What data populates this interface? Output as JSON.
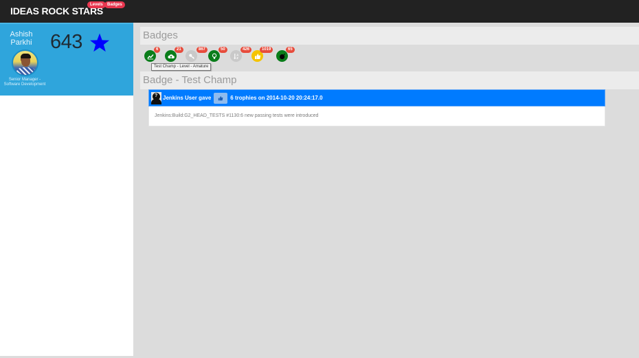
{
  "navbar": {
    "brand": "IDEAS ROCK STARS",
    "pills": [
      {
        "label": "Levels"
      },
      {
        "label": "Badges"
      }
    ],
    "pill_color": "#e8364f"
  },
  "profile": {
    "first_name": "Ashish",
    "last_name": "Parkhi",
    "job_title": "Senior Manager - Software Development",
    "score": "643",
    "card_color": "#2fa5dc",
    "star_color": "#0000ff"
  },
  "badges_section": {
    "title": "Badges",
    "items": [
      {
        "icon": "trend-chart-icon",
        "count": "6",
        "color": "#0a7d1a"
      },
      {
        "icon": "cloud-upload-icon",
        "count": "21",
        "color": "#0a7d1a"
      },
      {
        "icon": "key-icon",
        "count": "867",
        "color": "#c9c9c9"
      },
      {
        "icon": "lightbulb-icon",
        "count": "50",
        "color": "#0a7d1a"
      },
      {
        "icon": "sort-alpha-icon",
        "count": "426",
        "color": "#c9c9c9"
      },
      {
        "icon": "thumbs-up-icon",
        "count": "1019",
        "color": "#f5c400"
      },
      {
        "icon": "bomb-icon",
        "count": "65",
        "color": "#0a7d1a"
      }
    ],
    "tooltip": "Test Champ - Level - Amature"
  },
  "badge_detail": {
    "title": "Badge - Test Champ",
    "activity": {
      "giver": "Jenkins User gave",
      "summary": "6 trophies on 2014-10-20 20:24:17.0",
      "description": "Jenkins:Build:G2_HEAD_TESTS #1130:6 new passing tests were introduced"
    }
  }
}
